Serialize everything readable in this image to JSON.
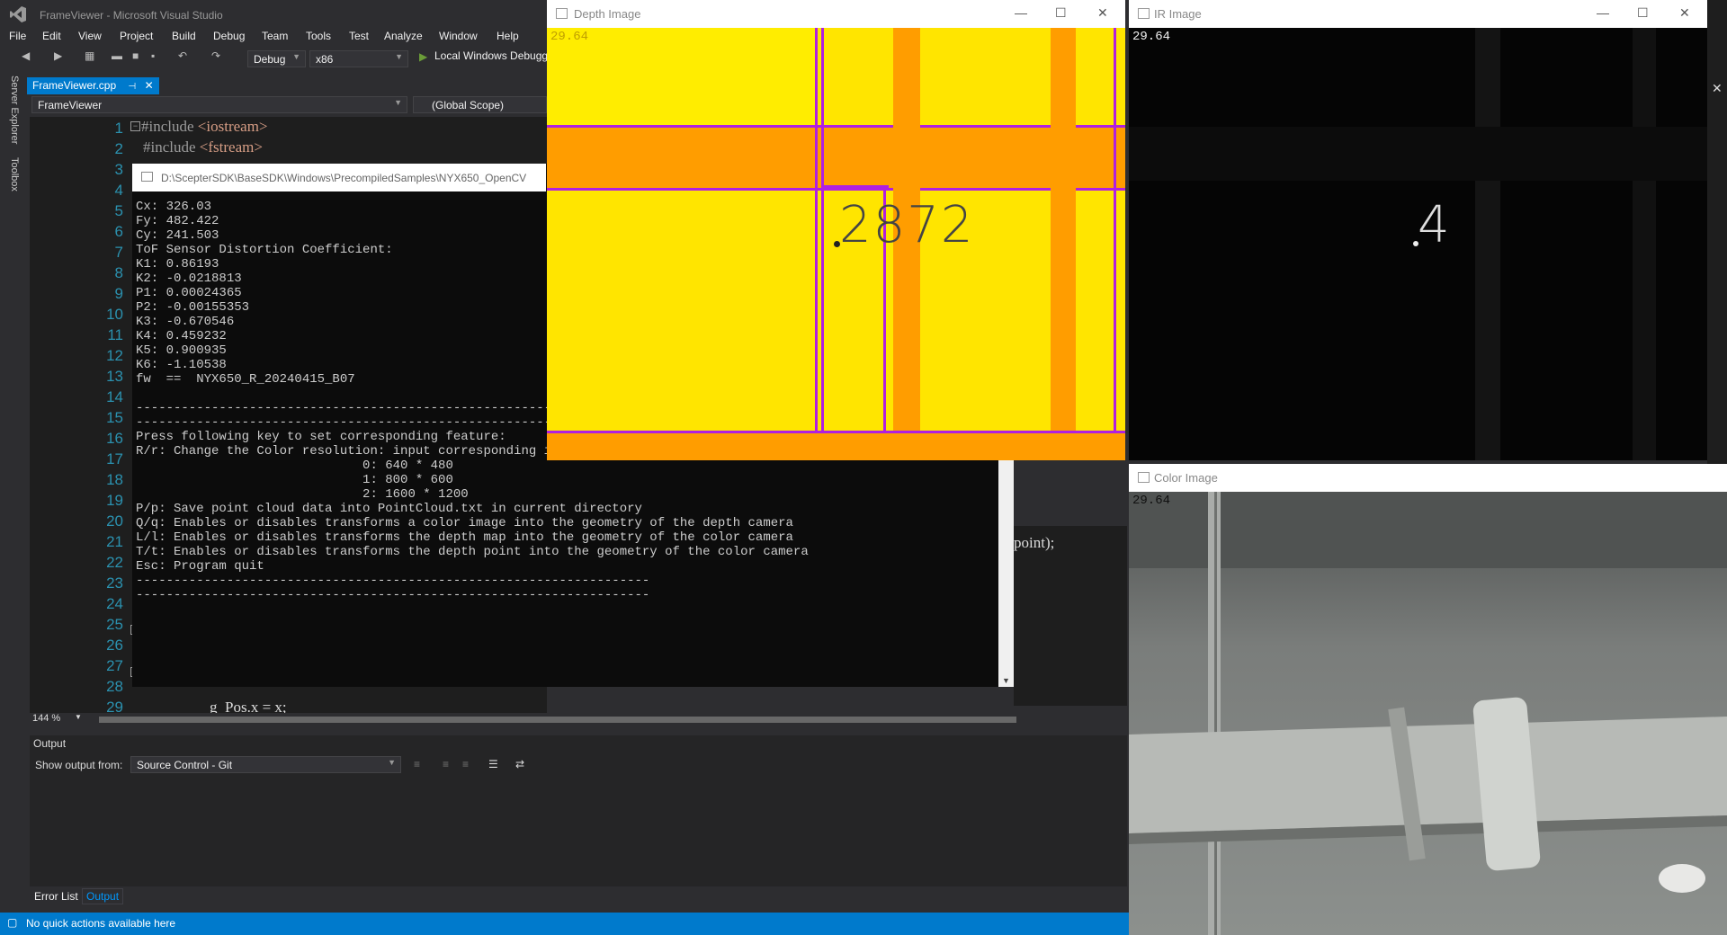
{
  "vs": {
    "title": "FrameViewer - Microsoft Visual Studio",
    "menus": [
      "File",
      "Edit",
      "View",
      "Project",
      "Build",
      "Debug",
      "Team",
      "Tools",
      "Test",
      "Analyze",
      "Window",
      "Help"
    ],
    "config": "Debug",
    "platform": "x86",
    "run_label": "Local Windows Debugg",
    "doc_tab": "FrameViewer.cpp",
    "nav_left": "FrameViewer",
    "nav_right": "(Global Scope)",
    "side_labels": [
      "Server Explorer",
      "Toolbox"
    ],
    "zoom": "144 %",
    "output_title": "Output",
    "show_output_from_label": "Show output from:",
    "show_output_from_value": "Source Control - Git",
    "bottom_tabs": [
      "Error List",
      "Output"
    ],
    "status": "No quick actions available here",
    "line_numbers": [
      "1",
      "2",
      "3",
      "4",
      "5",
      "6",
      "7",
      "8",
      "9",
      "10",
      "11",
      "12",
      "13",
      "14",
      "15",
      "16",
      "17",
      "18",
      "19",
      "20",
      "21",
      "22",
      "23",
      "24",
      "25",
      "26",
      "27",
      "28",
      "29"
    ],
    "code": {
      "l1a": "#include ",
      "l1b": "<iostream>",
      "l2a": "#include ",
      "l2b": "<fstream>",
      "l22": "point);",
      "l29": "g_Pos.x = x;"
    }
  },
  "console": {
    "title": "D:\\ScepterSDK\\BaseSDK\\Windows\\PrecompiledSamples\\NYX650_OpenCV",
    "lines": [
      "Cx: 326.03",
      "Fy: 482.422",
      "Cy: 241.503",
      "ToF Sensor Distortion Coefficient:",
      "K1: 0.86193",
      "K2: -0.0218813",
      "P1: 0.00024365",
      "P2: -0.00155353",
      "K3: -0.670546",
      "K4: 0.459232",
      "K5: 0.900935",
      "K6: -1.10538",
      "fw  ==  NYX650_R_20240415_B07",
      "",
      "----------------------------------------------------------------------------------------------------",
      "----------------------------------------------------------------------------------------------------",
      "Press following key to set corresponding feature:",
      "R/r: Change the Color resolution: input corresponding ind",
      "                              0: 640 * 480",
      "                              1: 800 * 600",
      "                              2: 1600 * 1200",
      "P/p: Save point cloud data into PointCloud.txt in current directory",
      "Q/q: Enables or disables transforms a color image into the geometry of the depth camera",
      "L/l: Enables or disables transforms the depth map into the geometry of the color camera",
      "T/t: Enables or disables transforms the depth point into the geometry of the color camera",
      "Esc: Program quit",
      "--------------------------------------------------------------------",
      "--------------------------------------------------------------------"
    ]
  },
  "depth": {
    "title": "Depth Image",
    "fps": "29.64",
    "value": "2872"
  },
  "ir": {
    "title": "IR Image",
    "fps": "29.64",
    "value": "4"
  },
  "color": {
    "title": "Color Image",
    "fps": "29.64"
  },
  "colors": {
    "accent": "#007acc",
    "depth_yellow": "#ffff00",
    "depth_orange": "#ff9900",
    "depth_purple": "#b020e0"
  }
}
